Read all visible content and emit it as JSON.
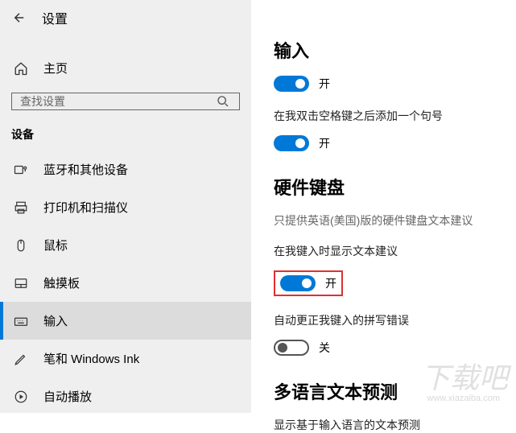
{
  "sidebar": {
    "title": "设置",
    "home": "主页",
    "search_placeholder": "查找设置",
    "category": "设备",
    "items": [
      {
        "label": "蓝牙和其他设备",
        "icon": "bluetooth"
      },
      {
        "label": "打印机和扫描仪",
        "icon": "printer"
      },
      {
        "label": "鼠标",
        "icon": "mouse"
      },
      {
        "label": "触摸板",
        "icon": "touchpad"
      },
      {
        "label": "输入",
        "icon": "keyboard"
      },
      {
        "label": "笔和 Windows Ink",
        "icon": "pen"
      },
      {
        "label": "自动播放",
        "icon": "autoplay"
      }
    ]
  },
  "main": {
    "section1": {
      "title": "输入"
    },
    "toggle1": {
      "state": "开"
    },
    "setting1": {
      "label": "在我双击空格键之后添加一个句号"
    },
    "toggle2": {
      "state": "开"
    },
    "section2": {
      "title": "硬件键盘",
      "subtext": "只提供英语(美国)版的硬件键盘文本建议"
    },
    "setting2": {
      "label": "在我键入时显示文本建议"
    },
    "toggle3": {
      "state": "开"
    },
    "setting3": {
      "label": "自动更正我键入的拼写错误"
    },
    "toggle4": {
      "state": "关"
    },
    "section3": {
      "title": "多语言文本预测"
    },
    "setting4": {
      "label": "显示基于输入语言的文本预测"
    }
  },
  "watermark": {
    "main": "下载吧",
    "sub": "www.xiazaiba.com"
  }
}
